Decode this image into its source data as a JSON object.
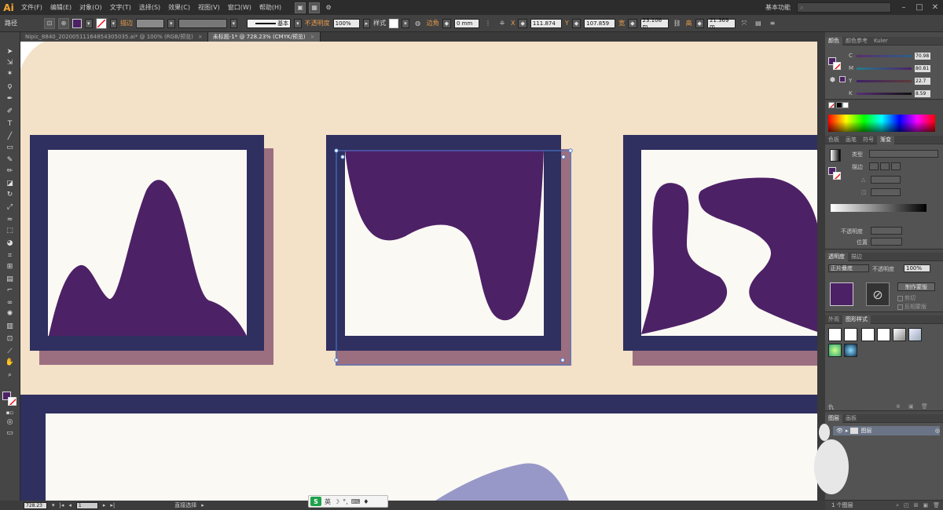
{
  "app": {
    "logo": "Ai"
  },
  "menu": [
    "文件(F)",
    "编辑(E)",
    "对象(O)",
    "文字(T)",
    "选择(S)",
    "效果(C)",
    "视图(V)",
    "窗口(W)",
    "帮助(H)"
  ],
  "workspace": "基本功能",
  "window_controls": [
    "–",
    "□",
    "✕"
  ],
  "control_bar": {
    "mode": "路径",
    "stroke_label": "描边",
    "stroke_style": "基本",
    "opacity_label": "不透明度",
    "opacity_value": "100%",
    "style_label": "样式",
    "corner_label": "边角",
    "corner_value": "0 mm",
    "x_label": "X",
    "x_value": "111.874",
    "y_label": "Y",
    "y_value": "107.859",
    "w_label": "宽",
    "w_value": "23.106 m",
    "h_label": "高",
    "h_value": "21.369 m",
    "fill_color": "#4d2166"
  },
  "tabs": [
    {
      "label": "Nipic_8840_20200511164854305035.ai* @ 100% (RGB/预览)",
      "active": false,
      "close": "×"
    },
    {
      "label": "未标题-1* @ 728.23% (CMYK/预览)",
      "active": true,
      "close": "×"
    }
  ],
  "colors": {
    "frame": "#2f3060",
    "shadow": "#9b6f80",
    "paper": "#fbf9f4",
    "shape": "#4d2166",
    "background": "#f3e1c8",
    "lilac": "#9898c8",
    "selection": "#4a7bd6"
  },
  "color_panel": {
    "tabs": [
      "颜色",
      "颜色参考",
      "Kuler"
    ],
    "channels": [
      {
        "label": "C",
        "value": "70.98"
      },
      {
        "label": "M",
        "value": "80.81"
      },
      {
        "label": "Y",
        "value": "22.7"
      },
      {
        "label": "K",
        "value": "8.59"
      }
    ]
  },
  "gradient_panel": {
    "tabs": [
      "色板",
      "画笔",
      "符号",
      "渐变"
    ],
    "type_label": "类型",
    "stroke_label": "描边",
    "opacity_label": "不透明度",
    "position_label": "位置"
  },
  "transparency_panel": {
    "tabs": [
      "透明度",
      "描边"
    ],
    "blend_mode": "正片叠底",
    "opacity_label": "不透明度",
    "opacity_value": "100%",
    "make_mask": "制作蒙版",
    "clip": "剪切",
    "invert": "反相蒙版"
  },
  "appearance_panel": {
    "tabs": [
      "外观",
      "图形样式"
    ],
    "footer_left": "仇"
  },
  "layers_panel": {
    "tabs": [
      "图层",
      "画板"
    ],
    "layer_name": "图层",
    "footer": "1 个图层"
  },
  "status": {
    "zoom": "728.23",
    "page": "1",
    "tool": "直接选择"
  },
  "ime": {
    "logo": "S",
    "label": "英",
    "icons": [
      "☽",
      "°,",
      "⌨",
      "♦"
    ]
  }
}
